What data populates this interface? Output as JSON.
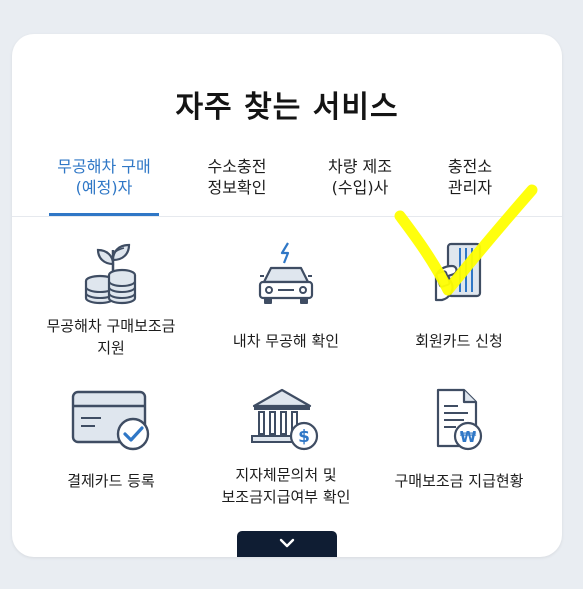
{
  "section": {
    "title": "자주 찾는 서비스"
  },
  "tabs": [
    {
      "line1": "무공해차 구매",
      "line2": "(예정)자",
      "active": true
    },
    {
      "line1": "수소충전",
      "line2": "정보확인",
      "active": false
    },
    {
      "line1": "차량 제조",
      "line2": "(수입)사",
      "active": false
    },
    {
      "line1": "충전소",
      "line2": "관리자",
      "active": false
    }
  ],
  "services": [
    {
      "line1": "무공해차 구매보조금",
      "line2": "지원",
      "icon": "plant-coins-icon"
    },
    {
      "line1": "내차 무공해 확인",
      "line2": "",
      "icon": "electric-car-icon"
    },
    {
      "line1": "회원카드 신청",
      "line2": "",
      "icon": "card-hand-icon"
    },
    {
      "line1": "결제카드 등록",
      "line2": "",
      "icon": "card-check-icon"
    },
    {
      "line1": "지자체문의처 및",
      "line2": "보조금지급여부 확인",
      "icon": "bank-dollar-icon"
    },
    {
      "line1": "구매보조금 지급현황",
      "line2": "",
      "icon": "document-won-icon"
    }
  ],
  "more_button": {
    "glyph": "⌄"
  },
  "colors": {
    "accent": "#2f77c6",
    "icon_dark": "#3f4d63",
    "icon_light": "#dfe6ee",
    "icon_blue": "#2f77c6",
    "button_bg": "#0f1d33",
    "highlight": "#ffff00"
  }
}
